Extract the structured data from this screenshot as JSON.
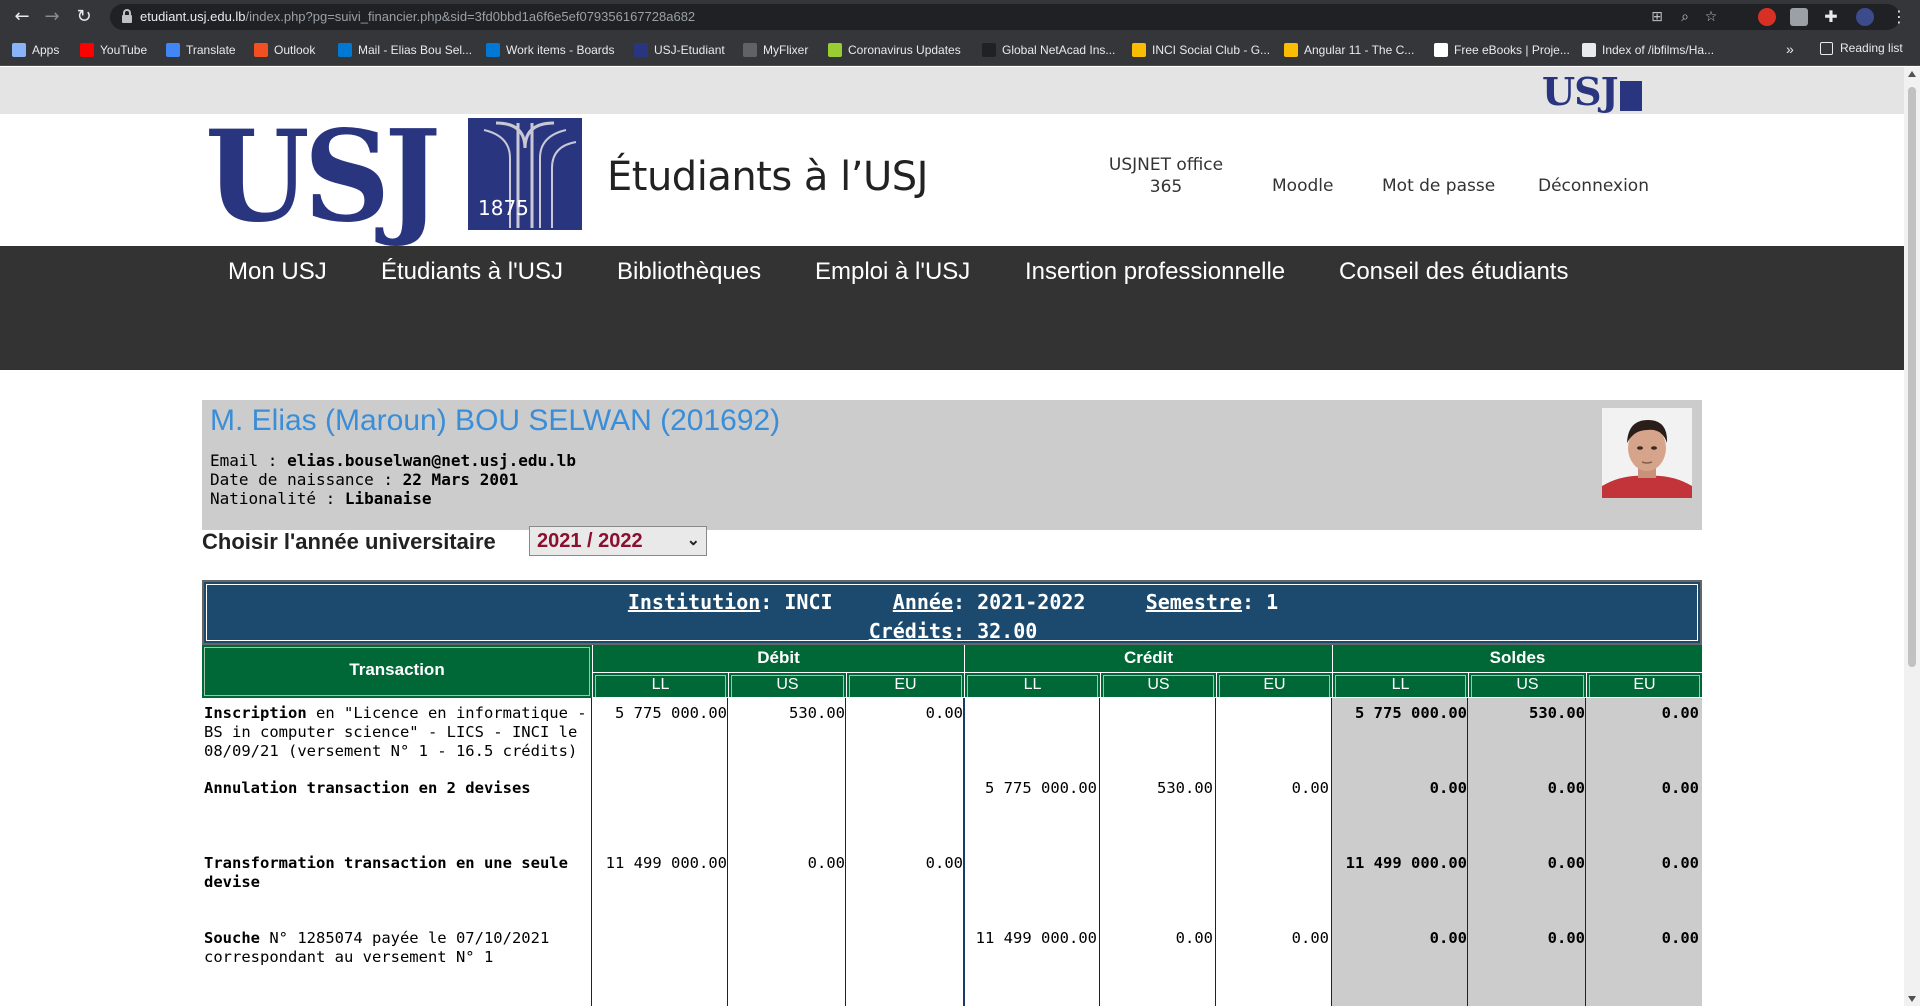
{
  "browser": {
    "url_host": "etudiant.usj.edu.lb",
    "url_path": "/index.php?pg=suivi_financier.php&sid=3fd0bbd1a6f6e5ef079356167728a682",
    "bookmarks": [
      {
        "label": "Apps",
        "color": "#8ab4f8"
      },
      {
        "label": "YouTube",
        "color": "#ff0000"
      },
      {
        "label": "Translate",
        "color": "#4285f4"
      },
      {
        "label": "Outlook",
        "color": "#f25022"
      },
      {
        "label": "Mail - Elias Bou Sel...",
        "color": "#0078d4"
      },
      {
        "label": "Work items - Boards",
        "color": "#0078d4"
      },
      {
        "label": "USJ-Etudiant",
        "color": "#2a3580"
      },
      {
        "label": "MyFlixer",
        "color": "#5f6368"
      },
      {
        "label": "Coronavirus Updates",
        "color": "#9acd32"
      },
      {
        "label": "Global NetAcad Ins...",
        "color": "#202124"
      },
      {
        "label": "INCI Social Club - G...",
        "color": "#fbbc04"
      },
      {
        "label": "Angular 11 - The C...",
        "color": "#fbbc04"
      },
      {
        "label": "Free eBooks | Proje...",
        "color": "#ffffff"
      },
      {
        "label": "Index of /ibfilms/Ha...",
        "color": "#e8eaed"
      }
    ],
    "more": "»",
    "reading_list": "Reading list"
  },
  "header": {
    "mini_logo": "USJ",
    "logo_text": "USJ",
    "logo_year": "1875",
    "site_title": "Étudiants à l’USJ",
    "links": {
      "office_line1": "USJNET office",
      "office_line2": "365",
      "moodle": "Moodle",
      "password": "Mot de passe",
      "logout": "Déconnexion"
    }
  },
  "nav": {
    "items": [
      "Mon USJ",
      "Étudiants à l'USJ",
      "Bibliothèques",
      "Emploi à l'USJ",
      "Insertion professionnelle",
      "Conseil des étudiants"
    ]
  },
  "student": {
    "name": "M. Elias (Maroun) BOU SELWAN (201692)",
    "email_label": "Email : ",
    "email": "elias.bouselwan@net.usj.edu.lb",
    "dob_label": "Date de naissance : ",
    "dob": "22 Mars 2001",
    "nationality_label": "Nationalité : ",
    "nationality": "Libanaise"
  },
  "year_selector": {
    "label": "Choisir l'année universitaire",
    "value": "2021 / 2022"
  },
  "finance": {
    "institution_label": "Institution",
    "institution": "INCI",
    "year_label": "Année",
    "year": "2021-2022",
    "semester_label": "Semestre",
    "semester": "1",
    "credits_label": "Crédits",
    "credits": "32.00",
    "headers": {
      "transaction": "Transaction",
      "debit": "Débit",
      "credit": "Crédit",
      "balance": "Soldes",
      "currencies": [
        "LL",
        "US",
        "EU"
      ]
    },
    "rows": [
      {
        "title": "Inscription",
        "detail": " en \"Licence en informatique - BS in computer science\" - LICS - INCI le 08/09/21 (versement N° 1 - 16.5 crédits)",
        "debit": [
          "5 775 000.00",
          "530.00",
          "0.00"
        ],
        "credit": [
          "",
          "",
          ""
        ],
        "balance": [
          "5 775 000.00",
          "530.00",
          "0.00"
        ]
      },
      {
        "title": "Annulation transaction en 2 devises",
        "detail": "",
        "debit": [
          "",
          "",
          ""
        ],
        "credit": [
          "5 775 000.00",
          "530.00",
          "0.00"
        ],
        "balance": [
          "0.00",
          "0.00",
          "0.00"
        ]
      },
      {
        "title": "Transformation transaction en une seule devise",
        "detail": "",
        "debit": [
          "11 499 000.00",
          "0.00",
          "0.00"
        ],
        "credit": [
          "",
          "",
          ""
        ],
        "balance": [
          "11 499 000.00",
          "0.00",
          "0.00"
        ]
      },
      {
        "title": "Souche",
        "detail": " N° 1285074 payée le 07/10/2021 correspondant au versement N° 1",
        "debit": [
          "",
          "",
          ""
        ],
        "credit": [
          "11 499 000.00",
          "0.00",
          "0.00"
        ],
        "balance": [
          "0.00",
          "0.00",
          "0.00"
        ]
      }
    ]
  }
}
